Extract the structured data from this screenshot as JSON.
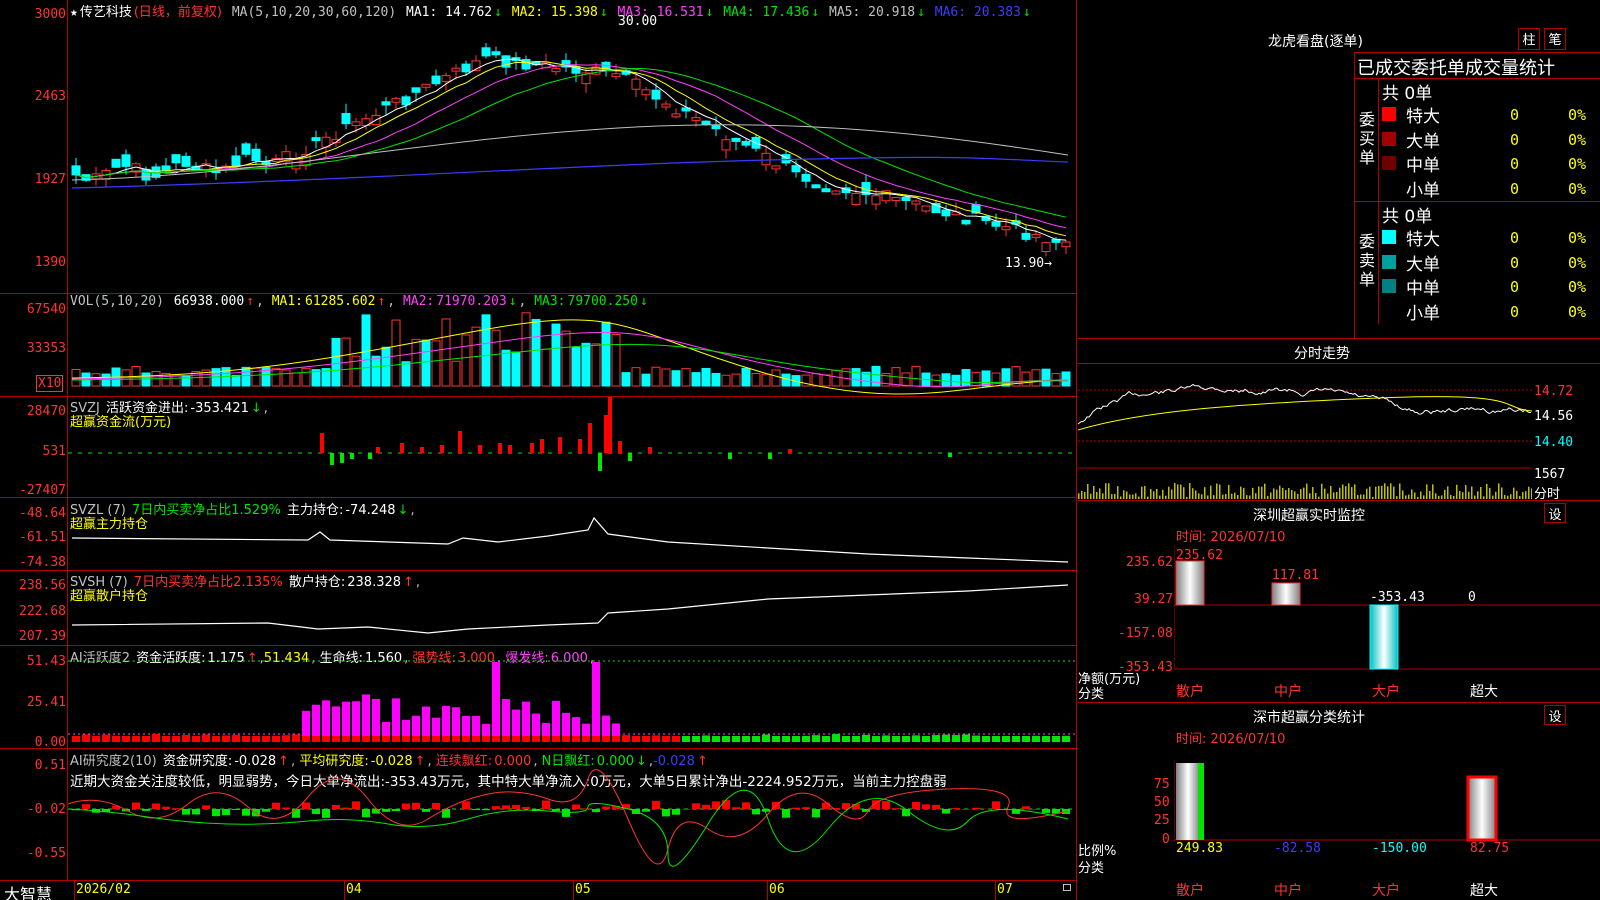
{
  "header": {
    "star": "★",
    "stock_name": "传艺科技",
    "period": "(日线，前复权)",
    "ma_label": "MA(5,10,20,30,60,120)",
    "ma": [
      {
        "label": "MA1:",
        "value": "14.762",
        "arrow": "↓",
        "color": "#ffffff"
      },
      {
        "label": "MA2:",
        "value": "15.398",
        "arrow": "↓",
        "color": "#ffff00"
      },
      {
        "label": "MA3:",
        "value": "16.531",
        "arrow": "↓",
        "color": "#ff40ff"
      },
      {
        "label": "MA4:",
        "value": "17.436",
        "arrow": "↓",
        "color": "#00e600"
      },
      {
        "label": "MA5:",
        "value": "20.918",
        "arrow": "↓",
        "color": "#c0c0c0"
      },
      {
        "label": "MA6:",
        "value": "20.383",
        "arrow": "↓",
        "color": "#3c3cff"
      }
    ],
    "high_label": "30.00",
    "low_label": "13.90→"
  },
  "price_axis": [
    "3000",
    "2463",
    "1927",
    "1390"
  ],
  "vol": {
    "header": "VOL(5,10,20)",
    "value": "66938.000",
    "ma1": "61285.602",
    "ma2": "71970.203",
    "ma3": "79700.250",
    "axis": [
      "67540",
      "33353",
      "X10"
    ]
  },
  "svzj": {
    "header": "SVZJ",
    "title": "活跃资金进出:",
    "value": "-353.421",
    "sub": "超赢资金流(万元)",
    "axis": [
      "28470",
      "531",
      "-27407"
    ]
  },
  "svzl": {
    "header": "SVZL (7)",
    "text1": "7日内买卖净占比1.529%",
    "text2": "主力持仓:",
    "value": "-74.248",
    "sub": "超赢主力持仓",
    "axis": [
      "-48.64",
      "-61.51",
      "-74.38"
    ]
  },
  "svsh": {
    "header": "SVSH (7)",
    "text1": "7日内买卖净占比2.135%",
    "text2": "散户持仓:",
    "value": "238.328",
    "sub": "超赢散户持仓",
    "axis": [
      "238.56",
      "222.68",
      "207.39"
    ]
  },
  "ai1": {
    "header": "AI活跃度2",
    "l1": "资金活跃度:",
    "v1": "1.175",
    "v2": "51.434",
    "l3": "生命线:",
    "v3": "1.560",
    "l4": "强势线:",
    "v4": "3.000",
    "l5": "爆发线:",
    "v5": "6.000",
    "axis": [
      "51.43",
      "25.41",
      "0.00"
    ]
  },
  "ai2": {
    "header": "AI研究度2(10)",
    "l1": "资金研究度:",
    "v1": "-0.028",
    "l2": "平均研究度:",
    "v2": "-0.028",
    "l3": "连续飘红:",
    "v3": "0.000",
    "l4": "N日飘红:",
    "v4": "0.000",
    "v5": "-0.028",
    "comment": "近期大资金关注度较低，明显弱势，今日大单净流出:-353.43万元，其中特大单净流入:0万元，大单5日累计净出-2224.952万元，当前主力控盘弱",
    "axis": [
      "0.51",
      "-0.02",
      "-0.55"
    ]
  },
  "dates": [
    "2026/02",
    "04",
    "05",
    "06",
    "07"
  ],
  "brand": "大智慧",
  "panel_lhb": {
    "title": "龙虎看盘(逐单)",
    "btn1": "柱",
    "btn2": "笔",
    "subtitle": "已成交委托单成交量统计",
    "buy_label": "委买单",
    "sell_label": "委卖单",
    "buy_total": "共 0单",
    "sell_total": "共 0单",
    "buy_rows": [
      {
        "name": "特大",
        "n": "0",
        "p": "0%",
        "color": "#ff0000"
      },
      {
        "name": "大单",
        "n": "0",
        "p": "0%",
        "color": "#a00000"
      },
      {
        "name": "中单",
        "n": "0",
        "p": "0%",
        "color": "#700000"
      },
      {
        "name": "小单",
        "n": "0",
        "p": "0%",
        "color": "#000000"
      }
    ],
    "sell_rows": [
      {
        "name": "特大",
        "n": "0",
        "p": "0%",
        "color": "#00ffff"
      },
      {
        "name": "大单",
        "n": "0",
        "p": "0%",
        "color": "#00a0a0"
      },
      {
        "name": "中单",
        "n": "0",
        "p": "0%",
        "color": "#008080"
      },
      {
        "name": "小单",
        "n": "0",
        "p": "0%",
        "color": "#000000"
      }
    ]
  },
  "panel_intraday": {
    "title": "分时走势",
    "axis": [
      "14.72",
      "14.56",
      "14.40"
    ],
    "vol_top": "1567",
    "vol_unit": "分时"
  },
  "panel_monitor": {
    "title": "深圳超赢实时监控",
    "btn": "设",
    "time_label": "时间: 2026/07/10",
    "axis": [
      "235.62",
      "39.27",
      "-157.08",
      "-353.43"
    ],
    "bar_labels": [
      "235.62",
      "117.81",
      "-353.43",
      "0"
    ],
    "ylabel1": "净额(万元)",
    "ylabel2": "分类",
    "categories": [
      "散户",
      "中户",
      "大户",
      "超大"
    ]
  },
  "panel_class": {
    "title": "深市超赢分类统计",
    "btn": "设",
    "time_label": "时间: 2026/07/10",
    "axis": [
      "75",
      "50",
      "25",
      "0"
    ],
    "values": [
      "249.83",
      "-82.58",
      "-150.00",
      "82.75"
    ],
    "ylabel1": "比例%",
    "ylabel2": "分类",
    "categories": [
      "散户",
      "中户",
      "大户",
      "超大"
    ]
  }
}
